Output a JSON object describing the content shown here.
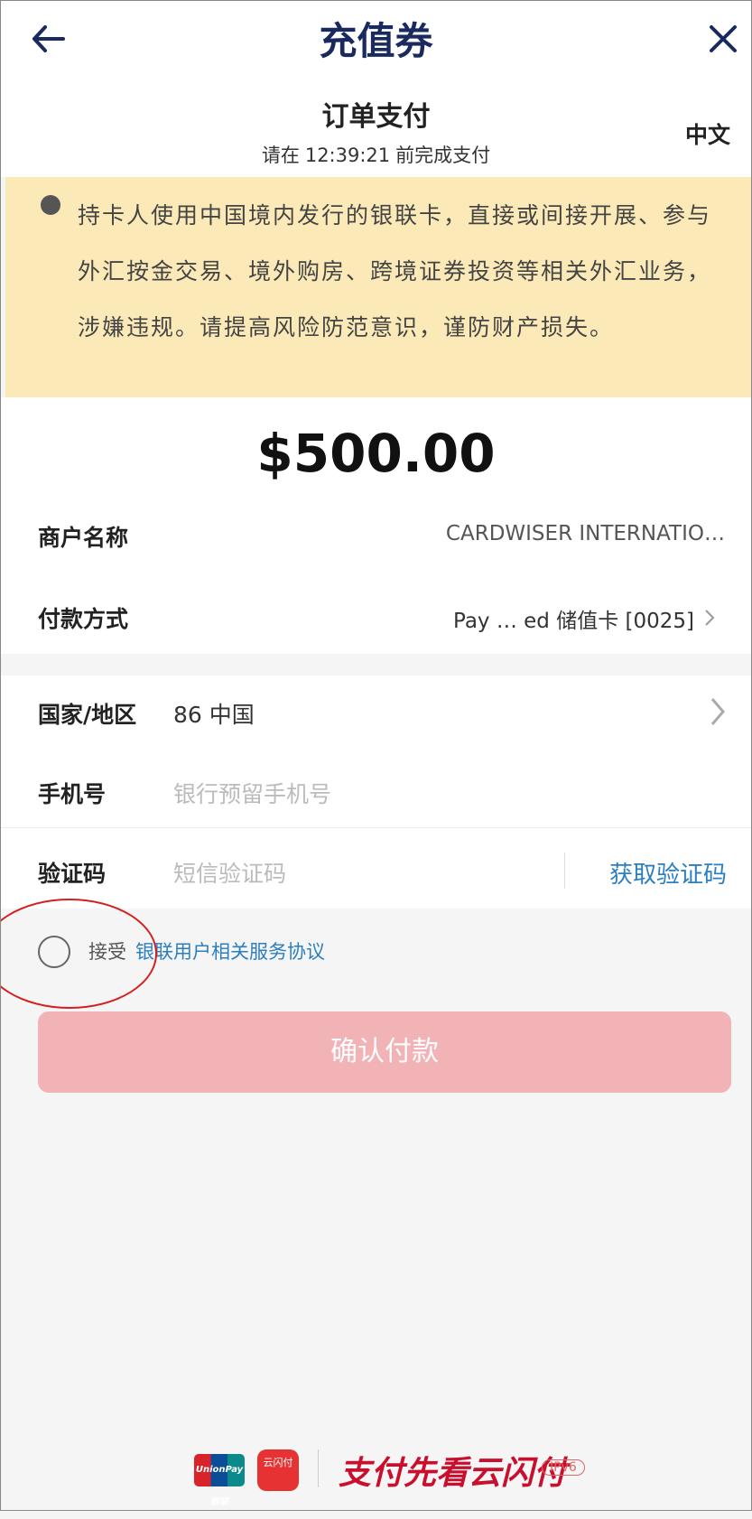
{
  "header": {
    "app_title": "充值券",
    "page_title": "订单支付",
    "deadline_prefix": "请在",
    "deadline_time": "12:39:21",
    "deadline_suffix": "前完成支付",
    "language_label": "中文"
  },
  "notice": {
    "text": "持卡人使用中国境内发行的银联卡，直接或间接开展、参与外汇按金交易、境外购房、跨境证券投资等相关外汇业务，涉嫌违规。请提高风险防范意识，谨防财产损失。"
  },
  "order": {
    "amount": "$500.00",
    "merchant_label": "商户名称",
    "merchant_value": "CARDWISER INTERNATIO…",
    "payment_label": "付款方式",
    "payment_value": "Pay … ed 储值卡 [0025]"
  },
  "form": {
    "country_label": "国家/地区",
    "country_value": "86 中国",
    "phone_label": "手机号",
    "phone_placeholder": "银行预留手机号",
    "code_label": "验证码",
    "code_placeholder": "短信验证码",
    "get_code_label": "获取验证码"
  },
  "agreement": {
    "accept_label": "接受",
    "link_text": "银联用户相关服务协议"
  },
  "confirm_label": "确认付款",
  "footer": {
    "unionpay_logo": "UnionPay 银联",
    "app_logo": "云闪付",
    "slogan": "支付先看云闪付",
    "ipv6_badge": "IPv6"
  },
  "colors": {
    "title": "#1a2a5e",
    "notice_bg": "#fbeab8",
    "link": "#2b7fc1",
    "confirm_bg": "#f2b3b6",
    "slogan": "#c8102e"
  },
  "icons": {
    "back": "arrow-left-icon",
    "close": "close-icon",
    "chevron": "chevron-right-icon"
  }
}
